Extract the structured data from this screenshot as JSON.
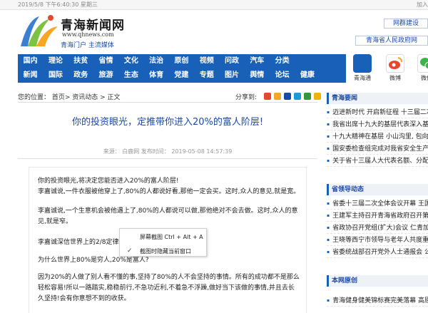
{
  "topbar": {
    "date": "2019/5/8 下午6:40:30 星期三",
    "join": "加入"
  },
  "logo": {
    "name": "青海新闻网",
    "url": "www.qhnews.com",
    "slogan": "青海门户  主流媒体"
  },
  "header": {
    "net_build": "网群建设",
    "gov_link": "青海省人民政府网"
  },
  "nav": {
    "row1": [
      "国内",
      "理论",
      "扶贫",
      "省情",
      "文化",
      "法治",
      "原创",
      "视频",
      "问政",
      "汽车",
      "分类"
    ],
    "row2": [
      "新闻",
      "国际",
      "政务",
      "旅游",
      "生态",
      "体育",
      "党建",
      "专题",
      "图片",
      "舆情",
      "论坛",
      "健康"
    ]
  },
  "apps": [
    {
      "label": "青海通",
      "color": "#1961b8"
    },
    {
      "label": "微博",
      "color": "#e8472f"
    },
    {
      "label": "微信",
      "color": "#3bb54a"
    }
  ],
  "breadcrumb": "您的位置：  首页>  资讯动态  > 正文",
  "share_label": "分享到:",
  "article": {
    "title": "你的投资眼光，定推带你进入20%的富人阶层!",
    "meta": "来源：  白鹿网     发布时间：  2019-05-08 14:57:39",
    "paragraphs": [
      "你的投资眼光,将决定您能否进入20%的富人阶层!",
      "李嘉诚说,一件衣服被他穿上了,80%的人都说好看,那他一定会买。这时,众人的意见,就是宽。",
      "李嘉诚说,一个生意机会被他遇上了,80%的人都说可以做,那他绝对不会去做。这时,众人的意见,就是窄。",
      "李嘉诚深信世界上的2/8定律。",
      "为什么世界上80%是穷人,20%是富人?",
      "因为20%的人做了别人看不懂的事,坚持了80%的人不会坚持的事情。所有的成功都不是那么轻松容易!所以一路踏实,稳稳前行,不急功近利,不着急不浮躁,做好当下该做的事情,并且去长久坚持!会有你意想不到的收获。"
    ]
  },
  "context_menu": {
    "item1": "屏幕截图 Ctrl + Alt + A",
    "item2": "截图时隐藏当前窗口",
    "check": "✓"
  },
  "sidebar": {
    "sections": [
      {
        "title": "青海要闻",
        "items": [
          "迈进新时代 开启新征程 十三届二次",
          "我省出席十九大的基层代表深入基层",
          "十九大精神在基层 小山沟里, 包向党",
          "国安委检查组完成对我省安全生产考",
          "关于省十三届人大代表名额、分配方案"
        ]
      },
      {
        "title": "省领导动态",
        "items": [
          "省委十三届二次全体会议开幕 王国生",
          "王建军主持召开青海省政府召开第",
          "省政协召开党组(扩大)会议 仁青加主",
          "王晓等西宁市领导与老年人共度重阳",
          "省委统战部召开党外人士通报会 公"
        ]
      },
      {
        "title": "本网原创",
        "items": [
          "青海健身健美锦标赛完美落幕 高原"
        ]
      }
    ]
  },
  "colors": {
    "nav": "#1961b8",
    "title": "#1a4aa8"
  }
}
